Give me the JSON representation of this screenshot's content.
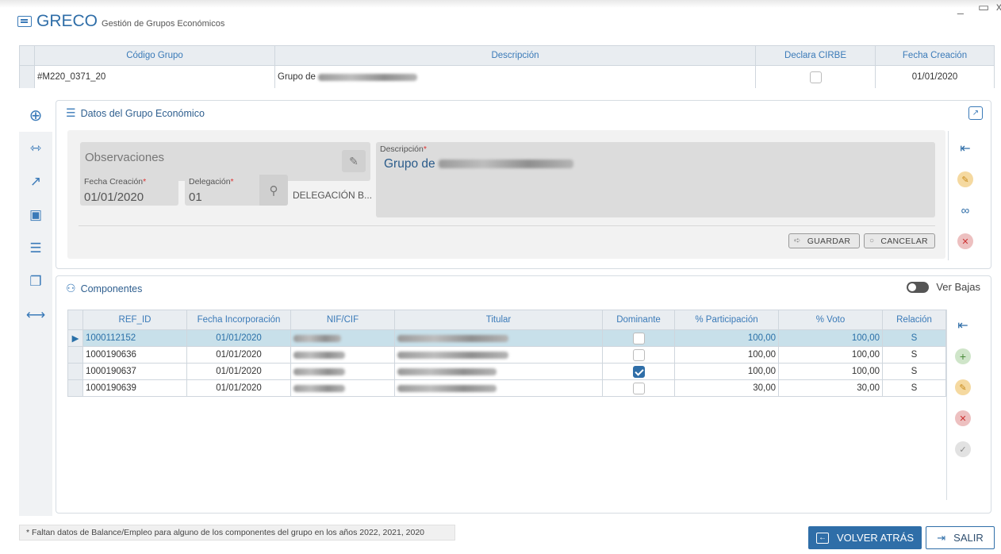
{
  "app": {
    "name": "GRECO",
    "subtitle": "Gestión de Grupos Económicos"
  },
  "window_controls": {
    "minimize": "_",
    "maximize": "▭"
  },
  "group_table": {
    "headers": [
      "Código Grupo",
      "Descripción",
      "Declara CIRBE",
      "Fecha Creación"
    ],
    "row": {
      "codigo": "#M220_0371_20",
      "descripcion": "Grupo de",
      "declara_cirbe": false,
      "fecha": "01/01/2020"
    }
  },
  "sidebar": {
    "items": [
      {
        "name": "zoom-in-icon",
        "glyph": "⊕",
        "active": true
      },
      {
        "name": "group-link-icon",
        "glyph": "⇿",
        "active": false
      },
      {
        "name": "chart-money-icon",
        "glyph": "↗",
        "active": false
      },
      {
        "name": "document-person-icon",
        "glyph": "▣",
        "active": false
      },
      {
        "name": "list-sort-icon",
        "glyph": "☰",
        "active": false
      },
      {
        "name": "copy-pages-icon",
        "glyph": "❐",
        "active": false
      },
      {
        "name": "expand-horizontal-icon",
        "glyph": "⟷",
        "active": false
      }
    ]
  },
  "datos_panel": {
    "title": "Datos del Grupo Económico",
    "observaciones": "Observaciones",
    "fecha_creacion": {
      "label": "Fecha Creación",
      "value": "01/01/2020"
    },
    "delegacion": {
      "label": "Delegación",
      "value": "01",
      "description": "DELEGACIÓN B..."
    },
    "descripcion": {
      "label": "Descripción",
      "value": "Grupo de"
    },
    "buttons": {
      "guardar": "GUARDAR",
      "cancelar": "CANCELAR"
    },
    "required_mark": "*"
  },
  "componentes_panel": {
    "title": "Componentes",
    "ver_bajas": "Ver Bajas",
    "headers": [
      "REF_ID",
      "Fecha Incorporación",
      "NIF/CIF",
      "Titular",
      "Dominante",
      "% Participación",
      "% Voto",
      "Relación"
    ],
    "rows": [
      {
        "ref_id": "1000112152",
        "fecha": "01/01/2020",
        "dominante": false,
        "participacion": "100,00",
        "voto": "100,00",
        "relacion": "S",
        "selected": true
      },
      {
        "ref_id": "1000190636",
        "fecha": "01/01/2020",
        "dominante": false,
        "participacion": "100,00",
        "voto": "100,00",
        "relacion": "S",
        "selected": false
      },
      {
        "ref_id": "1000190637",
        "fecha": "01/01/2020",
        "dominante": true,
        "participacion": "100,00",
        "voto": "100,00",
        "relacion": "S",
        "selected": false
      },
      {
        "ref_id": "1000190639",
        "fecha": "01/01/2020",
        "dominante": false,
        "participacion": "30,00",
        "voto": "30,00",
        "relacion": "S",
        "selected": false
      }
    ]
  },
  "footer": {
    "note": "* Faltan datos de Balance/Empleo para alguno de los componentes del grupo en los años 2022, 2021, 2020",
    "back": "VOLVER ATRÁS",
    "exit": "SALIR"
  },
  "colors": {
    "accent": "#2f6ea8",
    "selected_row": "#c8e0ea",
    "header_bg": "#e9edf1"
  }
}
